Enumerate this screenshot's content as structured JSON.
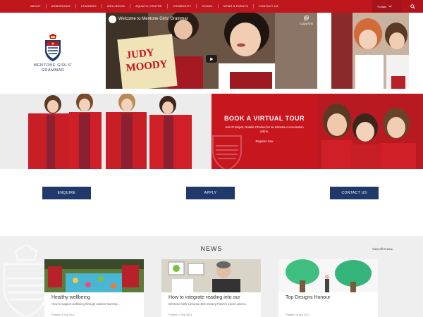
{
  "nav": {
    "links": [
      "About",
      "Admissions",
      "Learning",
      "Wellbeing",
      "Aquatic Centre",
      "Community",
      "Giving",
      "News & Events",
      "Contact Us"
    ],
    "portals_label": "Portals"
  },
  "school": {
    "name_line1": "MENTONE GIRLS'",
    "name_line2": "GRAMMAR"
  },
  "video": {
    "title": "Welcome to Mentone Girls' Grammar",
    "copy_label": "Copy link",
    "book_text_line1": "JUDY",
    "book_text_line2": "MOODY"
  },
  "tour": {
    "heading": "BOOK A VIRTUAL TOUR",
    "text": "Join Principal, Natalie Charles for an intimate conversation online.",
    "link": "Register now"
  },
  "buttons": {
    "enquire": "ENQUIRE",
    "apply": "APPLY",
    "contact": "CONTACT US"
  },
  "news": {
    "heading": "NEWS",
    "view_all": "View all news",
    "cards": [
      {
        "title": "Healthy wellbeing",
        "desc": "How to support wellbeing through outdoor learning ...",
        "date": "Posted: 3 Sep 2021"
      },
      {
        "title": "How to integrate reading into our",
        "desc": "Mentone Girls' Librarian Bek Dossey-Patch's expert advice...",
        "date": "Posted: 1 Sep 2021"
      },
      {
        "title": "Top Designs Honour",
        "desc": "",
        "date": "Posted: 18 Apr 2021"
      }
    ]
  },
  "colors": {
    "brand_red": "#c0161e",
    "navy": "#1f3a6a"
  }
}
